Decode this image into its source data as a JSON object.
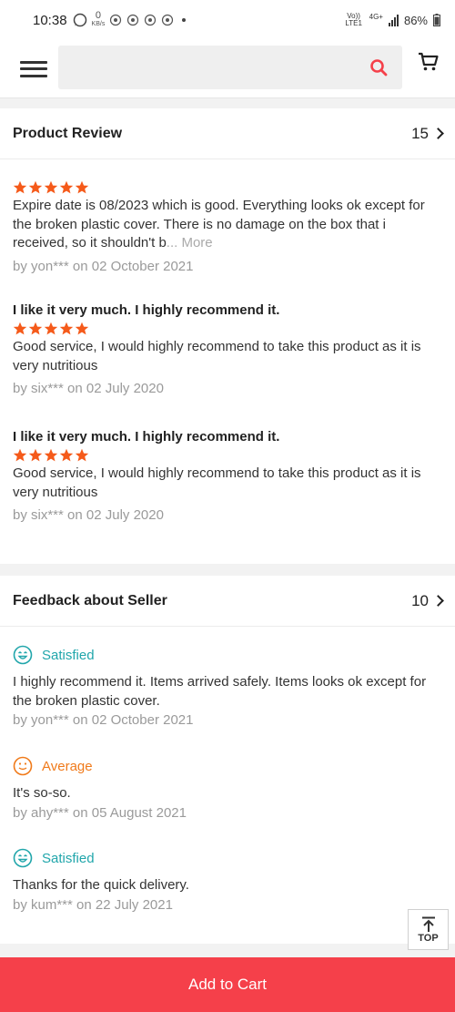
{
  "status_bar": {
    "time": "10:38",
    "net_speed": "0",
    "net_unit": "KB/s",
    "network": "Vo)) LTE1",
    "net_gen": "4G+",
    "battery": "86%"
  },
  "header": {
    "search_placeholder": "",
    "icons": [
      "menu-icon",
      "search-icon",
      "cart-icon"
    ]
  },
  "product_review": {
    "title": "Product Review",
    "count": "15",
    "reviews": [
      {
        "stars": 5,
        "title": "",
        "text": "Expire date is 08/2023 which is good. Everything looks ok except for the broken plastic cover. There is no damage on the box that i received, so it shouldn't b",
        "more": "... More",
        "meta": "by yon*** on 02 October 2021"
      },
      {
        "stars": 5,
        "title": "I like it very much. I highly recommend it.",
        "text": "Good service, I would highly recommend to take this product as it is very nutritious",
        "meta": "by six*** on 02 July 2020"
      },
      {
        "stars": 5,
        "title": "I like it very much. I highly recommend it.",
        "text": "Good service, I would highly recommend to take this product as it is very nutritious",
        "meta": "by six*** on 02 July 2020"
      }
    ]
  },
  "seller_feedback": {
    "title": "Feedback about Seller",
    "count": "10",
    "items": [
      {
        "rating": "Satisfied",
        "text": "I highly recommend it. Items arrived safely. Items looks ok except for the broken plastic cover.",
        "meta": "by yon*** on 02 October 2021"
      },
      {
        "rating": "Average",
        "text": "It's so-so.",
        "meta": "by ahy*** on 05 August 2021"
      },
      {
        "rating": "Satisfied",
        "text": "Thanks for the quick delivery.",
        "meta": "by kum*** on 22 July 2021"
      }
    ]
  },
  "top_button": {
    "label": "TOP"
  },
  "add_to_cart": {
    "label": "Add to Cart"
  },
  "colors": {
    "accent_red": "#f5404a",
    "star_orange": "#f55a1a",
    "satisfied_teal": "#21a6ab",
    "average_orange": "#f07a1a"
  }
}
